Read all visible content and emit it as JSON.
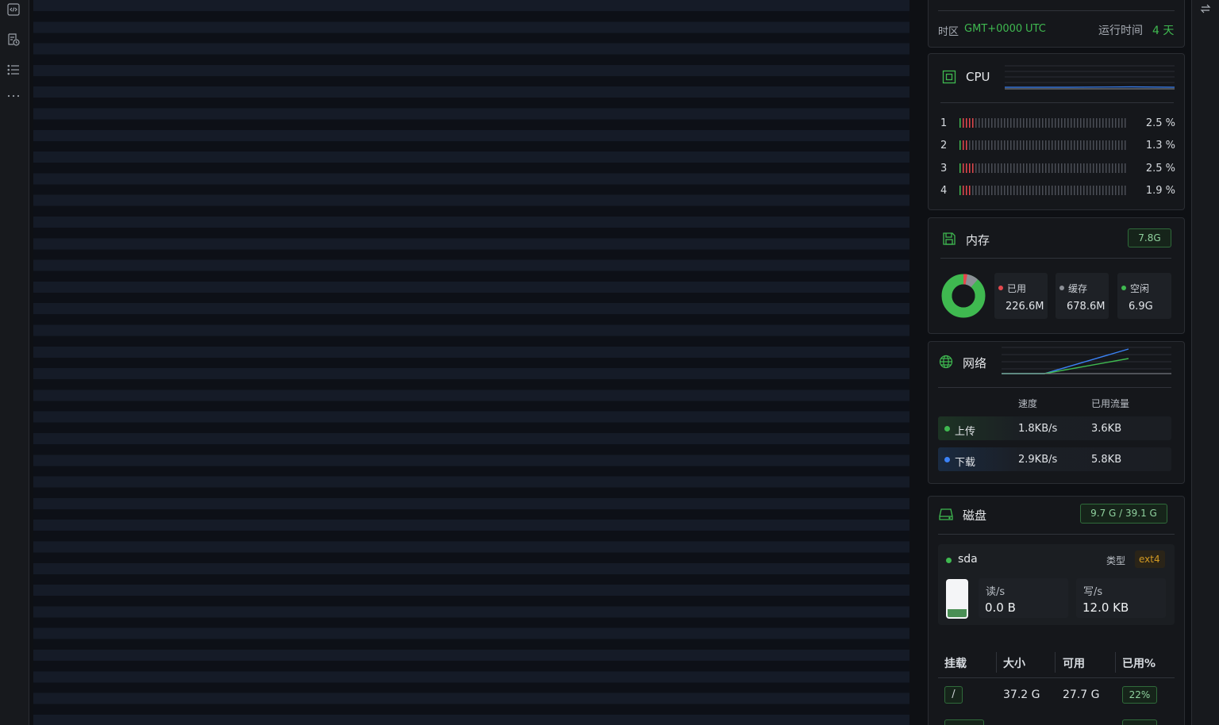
{
  "system": {
    "timezone_label": "时区",
    "timezone_offset": "GMT+0000",
    "timezone_name": "UTC",
    "uptime_label": "运行时间",
    "uptime_value": "4 天"
  },
  "cpu": {
    "title": "CPU",
    "cores": [
      {
        "index": "1",
        "percent_text": "2.5 %",
        "percent": 2.5
      },
      {
        "index": "2",
        "percent_text": "1.3 %",
        "percent": 1.3
      },
      {
        "index": "3",
        "percent_text": "2.5 %",
        "percent": 2.5
      },
      {
        "index": "4",
        "percent_text": "1.9 %",
        "percent": 1.9
      }
    ]
  },
  "memory": {
    "title": "内存",
    "total": "7.8G",
    "used_label": "已用",
    "used_value": "226.6M",
    "cache_label": "缓存",
    "cache_value": "678.6M",
    "free_label": "空闲",
    "free_value": "6.9G"
  },
  "network": {
    "title": "网络",
    "col_speed": "速度",
    "col_traffic": "已用流量",
    "upload_label": "上传",
    "upload_speed": "1.8KB/s",
    "upload_traffic": "3.6KB",
    "download_label": "下载",
    "download_speed": "2.9KB/s",
    "download_traffic": "5.8KB"
  },
  "disk": {
    "title": "磁盘",
    "summary": "9.7 G / 39.1 G",
    "device": "sda",
    "type_label": "类型",
    "type_value": "ext4",
    "read_label": "读/s",
    "read_value": "0.0 B",
    "write_label": "写/s",
    "write_value": "12.0 KB",
    "usage_fraction": 0.22,
    "table": {
      "headers": [
        "挂载",
        "大小",
        "可用",
        "已用%"
      ],
      "rows": [
        {
          "mount": "/",
          "size": "37.2 G",
          "avail": "27.7 G",
          "used_pct": "22%"
        }
      ]
    }
  },
  "colors": {
    "accent": "#3fb950",
    "used": "#e5484d",
    "cache": "#8b8f96",
    "upload": "#3fb950",
    "download": "#3b82f6",
    "ext4": "#d29922"
  },
  "icons": {
    "rail": [
      "code-icon",
      "file-clock-icon",
      "list-icon",
      "more-icon"
    ],
    "swap": "swap-arrows-icon"
  }
}
